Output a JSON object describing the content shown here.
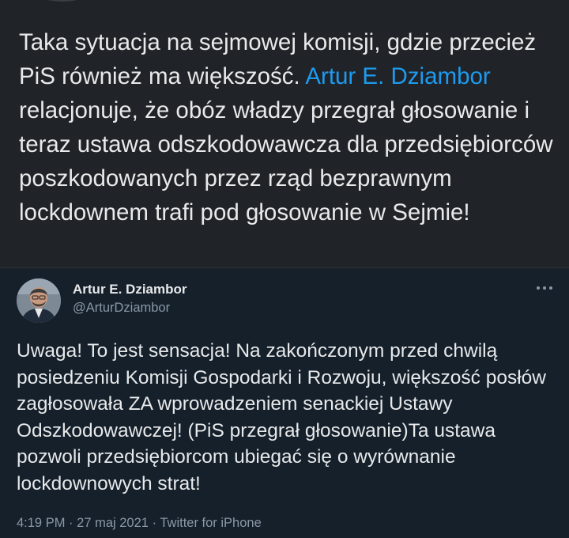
{
  "post": {
    "text_before": "Taka sytuacja na sejmowej komisji, gdzie przecież PiS również ma większość. ",
    "mention": "Artur E. Dziambor",
    "text_after": " relacjonuje, że obóz władzy przegrał głosowanie i teraz ustawa odszkodowawcza dla przedsiębiorców poszkodowanych przez rząd bezprawnym lockdownem trafi pod głosowanie w Sejmie!"
  },
  "quoted_tweet": {
    "author_name": "Artur E. Dziambor",
    "author_handle": "@ArturDziambor",
    "text": "Uwaga! To jest sensacja! Na zakończonym przed chwilą posiedzeniu Komisji Gospodarki i Rozwoju, większość posłów zagłosowała ZA wprowadzeniem senackiej Ustawy Odszkodowawczej! (PiS przegrał głosowanie)Ta ustawa pozwoli przedsiębiorcom ubiegać się o wyrównanie lockdownowych strat!",
    "time": "4:19 PM",
    "date": "27 maj 2021",
    "source": "Twitter for iPhone",
    "separator": "·"
  },
  "icons": {
    "more": "more-horizontal-icon",
    "avatar": "profile-photo"
  },
  "colors": {
    "post_background": "#202327",
    "tweet_background": "#15202b",
    "mention": "#1d9bf0",
    "secondary_text": "#8b98a5"
  }
}
